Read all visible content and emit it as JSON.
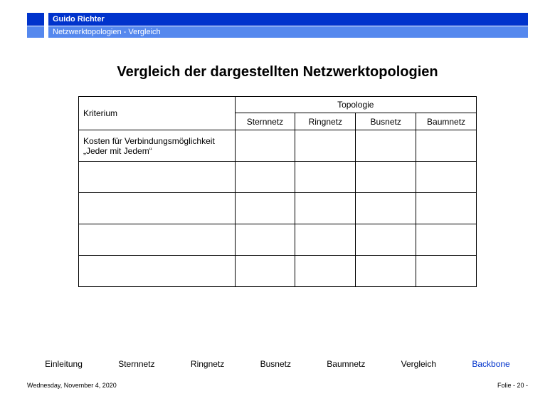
{
  "header": {
    "author": "Guido Richter",
    "breadcrumb": "Netzwerktopologien  - Vergleich"
  },
  "title": "Vergleich der dargestellten Netzwerktopologien",
  "table": {
    "criterion_header": "Kriterium",
    "topology_header": "Topologie",
    "columns": [
      "Sternnetz",
      "Ringnetz",
      "Busnetz",
      "Baumnetz"
    ],
    "rows": [
      "Kosten für Verbindungsmöglichkeit „Jeder mit Jedem“",
      "",
      "",
      "",
      ""
    ]
  },
  "nav": {
    "items": [
      "Einleitung",
      "Sternnetz",
      "Ringnetz",
      "Busnetz",
      "Baumnetz",
      "Vergleich",
      "Backbone"
    ],
    "active_index": 6
  },
  "footer": {
    "date": "Wednesday, November 4, 2020",
    "folio": "Folie - 20 -"
  }
}
